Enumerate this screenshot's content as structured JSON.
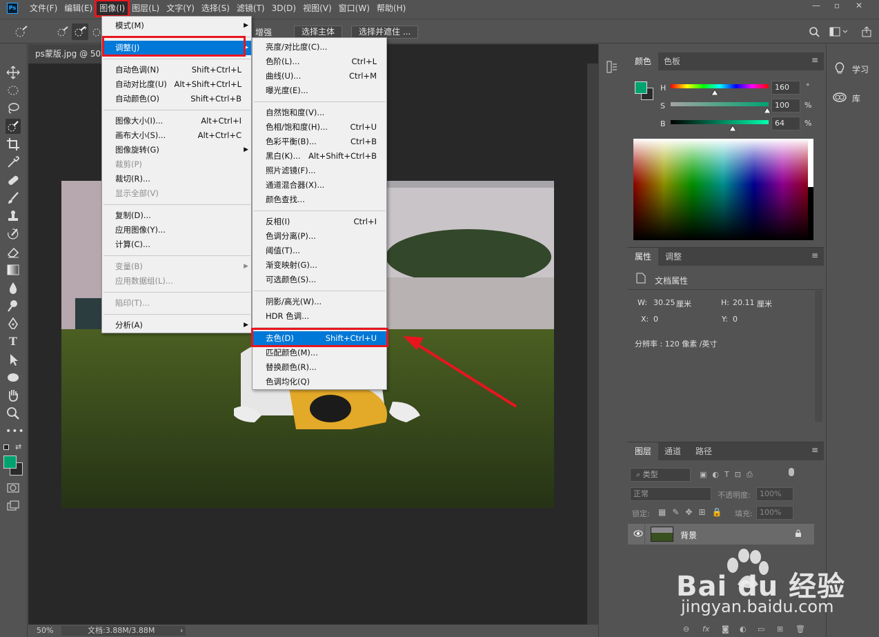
{
  "app": {
    "logo": "Ps"
  },
  "menubar": {
    "items": [
      {
        "label": "文件(F)"
      },
      {
        "label": "编辑(E)"
      },
      {
        "label": "图像(I)"
      },
      {
        "label": "图层(L)"
      },
      {
        "label": "文字(Y)"
      },
      {
        "label": "选择(S)"
      },
      {
        "label": "滤镜(T)"
      },
      {
        "label": "3D(D)"
      },
      {
        "label": "视图(V)"
      },
      {
        "label": "窗口(W)"
      },
      {
        "label": "帮助(H)"
      }
    ],
    "window_controls": {
      "minimize": "—",
      "restore": "▫",
      "close": "✕"
    }
  },
  "options": {
    "enhance_label": "增强",
    "select_subject": "选择主体",
    "select_mask": "选择并遮住 ..."
  },
  "document": {
    "tab_title": "ps蒙版.jpg @ 50%",
    "zoom": "50%",
    "doc_info": "文档:3.88M/3.88M"
  },
  "image_menu": {
    "items": [
      {
        "label": "模式(M)",
        "shortcut": "",
        "submenu": true
      },
      {
        "label": "调整(J)",
        "shortcut": "",
        "submenu": true,
        "highlighted": true
      },
      {
        "label": "自动色调(N)",
        "shortcut": "Shift+Ctrl+L"
      },
      {
        "label": "自动对比度(U)",
        "shortcut": "Alt+Shift+Ctrl+L"
      },
      {
        "label": "自动颜色(O)",
        "shortcut": "Shift+Ctrl+B"
      },
      {
        "label": "图像大小(I)...",
        "shortcut": "Alt+Ctrl+I"
      },
      {
        "label": "画布大小(S)...",
        "shortcut": "Alt+Ctrl+C"
      },
      {
        "label": "图像旋转(G)",
        "shortcut": "",
        "submenu": true
      },
      {
        "label": "裁剪(P)",
        "shortcut": "",
        "disabled": true
      },
      {
        "label": "裁切(R)...",
        "shortcut": ""
      },
      {
        "label": "显示全部(V)",
        "shortcut": "",
        "disabled": true
      },
      {
        "label": "复制(D)...",
        "shortcut": ""
      },
      {
        "label": "应用图像(Y)...",
        "shortcut": ""
      },
      {
        "label": "计算(C)...",
        "shortcut": ""
      },
      {
        "label": "变量(B)",
        "shortcut": "",
        "submenu": true,
        "disabled": true
      },
      {
        "label": "应用数据组(L)...",
        "shortcut": "",
        "disabled": true
      },
      {
        "label": "陷印(T)...",
        "shortcut": "",
        "disabled": true
      },
      {
        "label": "分析(A)",
        "shortcut": "",
        "submenu": true
      }
    ]
  },
  "adjust_menu": {
    "items": [
      {
        "label": "亮度/对比度(C)...",
        "shortcut": ""
      },
      {
        "label": "色阶(L)...",
        "shortcut": "Ctrl+L"
      },
      {
        "label": "曲线(U)...",
        "shortcut": "Ctrl+M"
      },
      {
        "label": "曝光度(E)...",
        "shortcut": ""
      },
      {
        "label": "自然饱和度(V)...",
        "shortcut": ""
      },
      {
        "label": "色相/饱和度(H)...",
        "shortcut": "Ctrl+U"
      },
      {
        "label": "色彩平衡(B)...",
        "shortcut": "Ctrl+B"
      },
      {
        "label": "黑白(K)...",
        "shortcut": "Alt+Shift+Ctrl+B"
      },
      {
        "label": "照片滤镜(F)...",
        "shortcut": ""
      },
      {
        "label": "通道混合器(X)...",
        "shortcut": ""
      },
      {
        "label": "颜色查找...",
        "shortcut": ""
      },
      {
        "label": "反相(I)",
        "shortcut": "Ctrl+I"
      },
      {
        "label": "色调分离(P)...",
        "shortcut": ""
      },
      {
        "label": "阈值(T)...",
        "shortcut": ""
      },
      {
        "label": "渐变映射(G)...",
        "shortcut": ""
      },
      {
        "label": "可选颜色(S)...",
        "shortcut": ""
      },
      {
        "label": "阴影/高光(W)...",
        "shortcut": ""
      },
      {
        "label": "HDR 色调...",
        "shortcut": ""
      },
      {
        "label": "去色(D)",
        "shortcut": "Shift+Ctrl+U",
        "highlighted": true
      },
      {
        "label": "匹配颜色(M)...",
        "shortcut": ""
      },
      {
        "label": "替换颜色(R)...",
        "shortcut": ""
      },
      {
        "label": "色调均化(Q)",
        "shortcut": ""
      }
    ]
  },
  "color_panel": {
    "tabs": [
      "颜色",
      "色板"
    ],
    "h": {
      "label": "H",
      "value": "160",
      "unit": "°",
      "fraction": 0.44
    },
    "s": {
      "label": "S",
      "value": "100",
      "unit": "%",
      "fraction": 1.0
    },
    "b": {
      "label": "B",
      "value": "64",
      "unit": "%",
      "fraction": 0.64
    },
    "foreground": "#00a370",
    "background": "#2b2b2b"
  },
  "properties_panel": {
    "tabs": [
      "属性",
      "调整"
    ],
    "title": "文档属性",
    "w_label": "W:",
    "w_value": "30.25",
    "w_unit": "厘米",
    "h_label": "H:",
    "h_value": "20.11",
    "h_unit": "厘米",
    "x_label": "X:",
    "x_value": "0",
    "y_label": "Y:",
    "y_value": "0",
    "resolution": "分辨率 : 120 像素 /英寸"
  },
  "learn_panel": {
    "learn": "学习",
    "library": "库"
  },
  "layers_panel": {
    "tabs": [
      "图层",
      "通道",
      "路径"
    ],
    "filter_kind": "类型",
    "blend_mode": "正常",
    "opacity_label": "不透明度:",
    "opacity_value": "100%",
    "lock_label": "锁定:",
    "fill_label": "填充:",
    "fill_value": "100%",
    "layer_name": "背景"
  },
  "watermark": {
    "brand": "Bai du 经验",
    "url": "jingyan.baidu.com"
  },
  "accent": {
    "highlight": "#0078d7",
    "red_box": "#e8151f"
  }
}
